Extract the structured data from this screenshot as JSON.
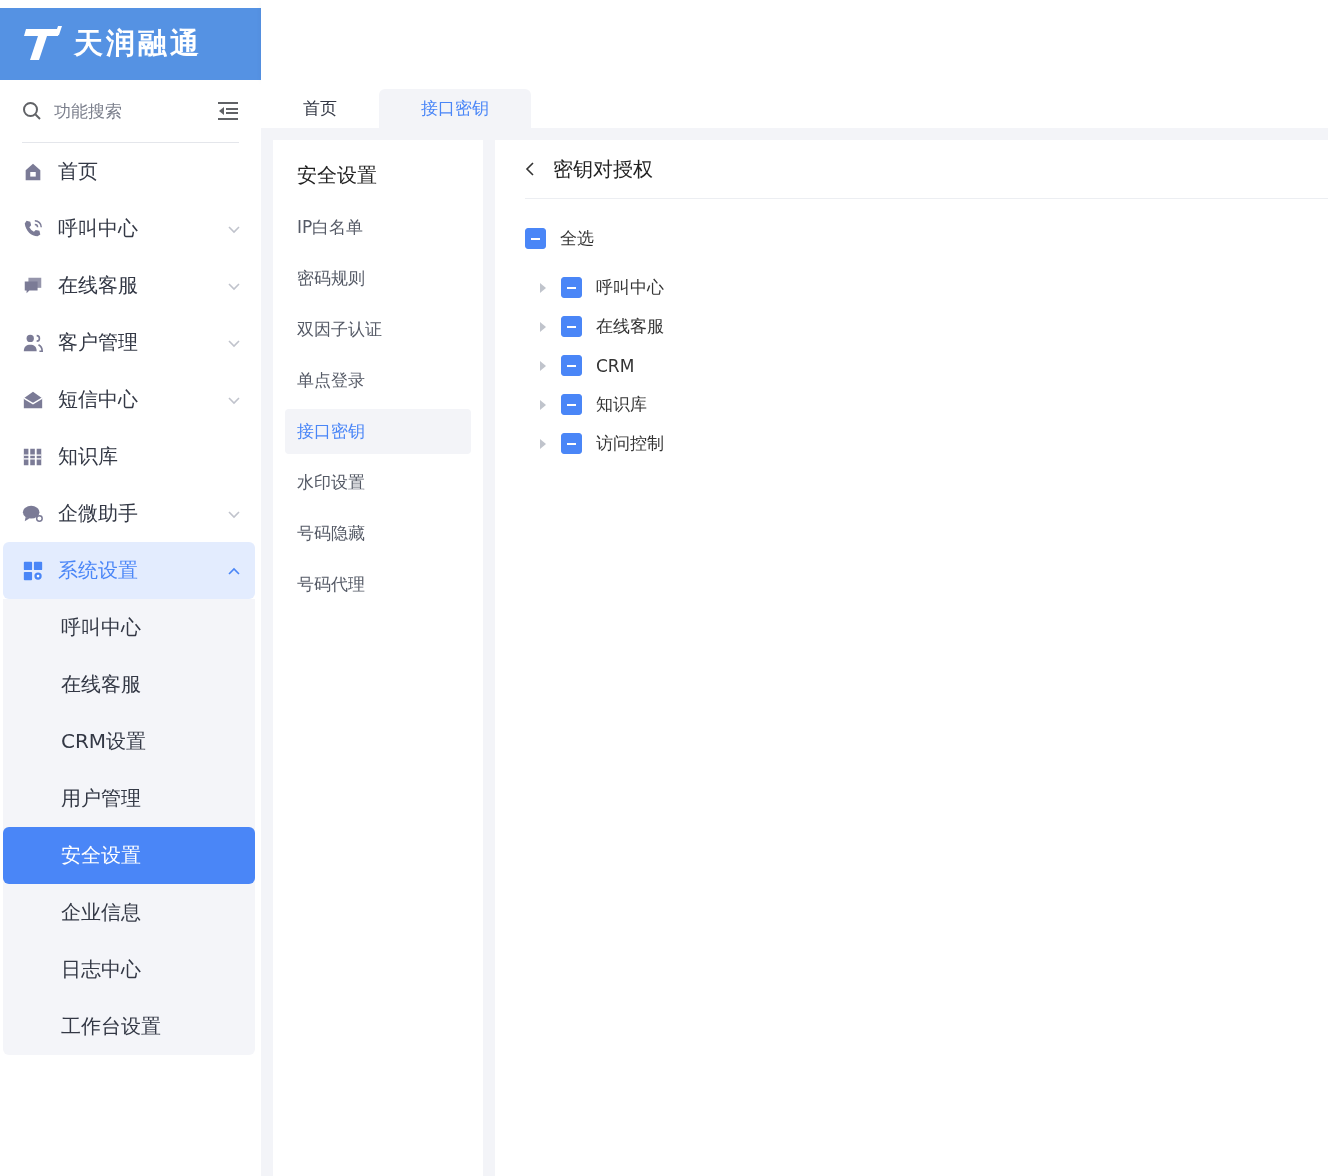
{
  "logo": {
    "text": "天润融通"
  },
  "sidebar": {
    "search": {
      "placeholder": "功能搜索"
    },
    "items": [
      {
        "label": "首页",
        "selected": false
      },
      {
        "label": "呼叫中心",
        "selected": false,
        "expanded": false
      },
      {
        "label": "在线客服",
        "selected": false,
        "expanded": false
      },
      {
        "label": "客户管理",
        "selected": false,
        "expanded": false
      },
      {
        "label": "短信中心",
        "selected": false,
        "expanded": false
      },
      {
        "label": "知识库",
        "selected": false
      },
      {
        "label": "企微助手",
        "selected": false,
        "expanded": false
      },
      {
        "label": "系统设置",
        "selected": true,
        "expanded": true,
        "children": [
          {
            "label": "呼叫中心",
            "selected": false
          },
          {
            "label": "在线客服",
            "selected": false
          },
          {
            "label": "CRM设置",
            "selected": false
          },
          {
            "label": "用户管理",
            "selected": false
          },
          {
            "label": "安全设置",
            "selected": true
          },
          {
            "label": "企业信息",
            "selected": false
          },
          {
            "label": "日志中心",
            "selected": false
          },
          {
            "label": "工作台设置",
            "selected": false
          }
        ]
      }
    ]
  },
  "tabs": [
    {
      "label": "首页",
      "selected": false
    },
    {
      "label": "接口密钥",
      "selected": true
    }
  ],
  "submenu": {
    "title": "安全设置",
    "items": [
      {
        "label": "IP白名单",
        "selected": false
      },
      {
        "label": "密码规则",
        "selected": false
      },
      {
        "label": "双因子认证",
        "selected": false
      },
      {
        "label": "单点登录",
        "selected": false
      },
      {
        "label": "接口密钥",
        "selected": true
      },
      {
        "label": "水印设置",
        "selected": false
      },
      {
        "label": "号码隐藏",
        "selected": false
      },
      {
        "label": "号码代理",
        "selected": false
      }
    ]
  },
  "panel": {
    "title": "密钥对授权",
    "select_all": {
      "label": "全选",
      "indeterminate": true
    },
    "tree": [
      {
        "label": "呼叫中心",
        "indeterminate": true,
        "expanded": false
      },
      {
        "label": "在线客服",
        "indeterminate": true,
        "expanded": false
      },
      {
        "label": "CRM",
        "indeterminate": true,
        "expanded": false
      },
      {
        "label": "知识库",
        "indeterminate": true,
        "expanded": false
      },
      {
        "label": "访问控制",
        "indeterminate": true,
        "expanded": false
      }
    ]
  }
}
